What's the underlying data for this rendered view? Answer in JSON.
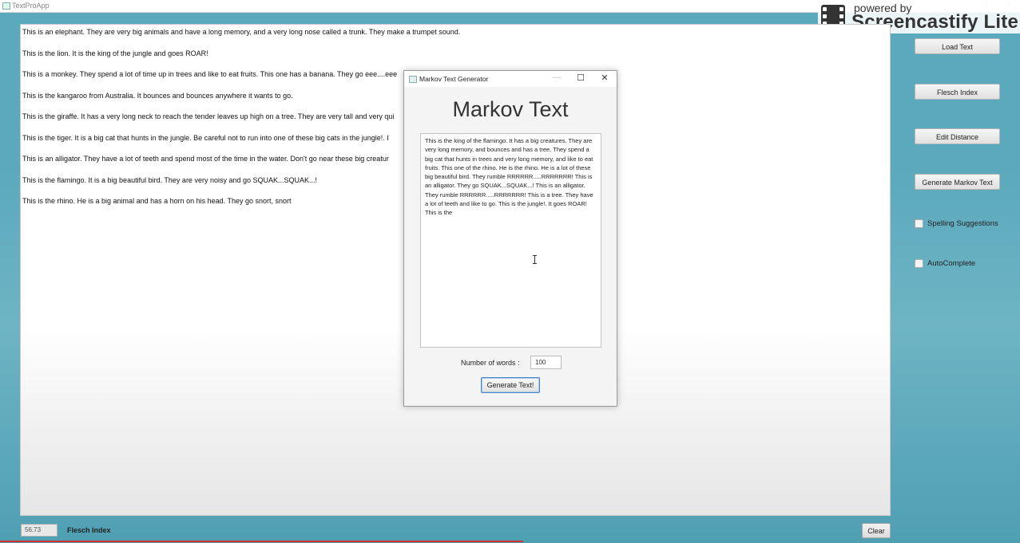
{
  "app": {
    "title": "TextProApp"
  },
  "watermark": {
    "powered": "powered by",
    "brand": "Screencastify Lite"
  },
  "main_text": {
    "lines": [
      "This is an elephant. They are very big animals and have a long memory, and a very long nose called a trunk. They make a trumpet sound.",
      "This is the lion. It is the king of the jungle and goes ROAR!",
      "This is a monkey. They spend a lot of time up in trees and like to eat fruits. This one has a banana. They go eee....eee",
      "This is the kangaroo from Australia. It bounces and bounces anywhere it wants to go.",
      "This is the giraffe. It has a very long neck to reach the tender leaves up high on a tree. They are very tall and very qui",
      "This is the tiger. It is a big cat that hunts in the jungle. Be careful not to run into one of these big cats in the jungle!. I",
      "This is an alligator. They have a lot of teeth and spend most of the time in the water. Don't go near these big creatur",
      "This is the flamingo. It is a big beautiful bird. They are very noisy and go SQUAK...SQUAK...!",
      "This is the rhino. He is a big animal and has a horn on his head. They go snort, snort"
    ]
  },
  "sidebar": {
    "load_text": "Load Text",
    "flesch_index": "Flesch Index",
    "edit_distance": "Edit Distance",
    "generate_markov": "Generate Markov Text",
    "spelling_suggestions": "Spelling Suggestions",
    "autocomplete": "AutoComplete"
  },
  "footer": {
    "score": "56.73",
    "score_label": "Flesch Index",
    "clear": "Clear"
  },
  "dialog": {
    "title": "Markov Text Generator",
    "heading": "Markov Text",
    "generated_text": "This  is the king of the flamingo. It has a big creatures. They are very long memory, and bounces and has a tree. They spend a big cat that hunts in trees and very long memory, and like to eat fruits. This one of the rhino. He is the rhino. He is a lot of these big beautiful bird. They rumble RRRRRR.....RRRRRRR! This is an alligator. They go SQUAK...SQUAK...! This is an alligator. They rumble RRRRRR.....RRRRRRR! This is a tree. They have a lot of teeth and like to go. This is the jungle!. It goes ROAR! This is the",
    "words_label": "Number of words :",
    "words_value": "100",
    "generate_button": "Generate Text!"
  }
}
